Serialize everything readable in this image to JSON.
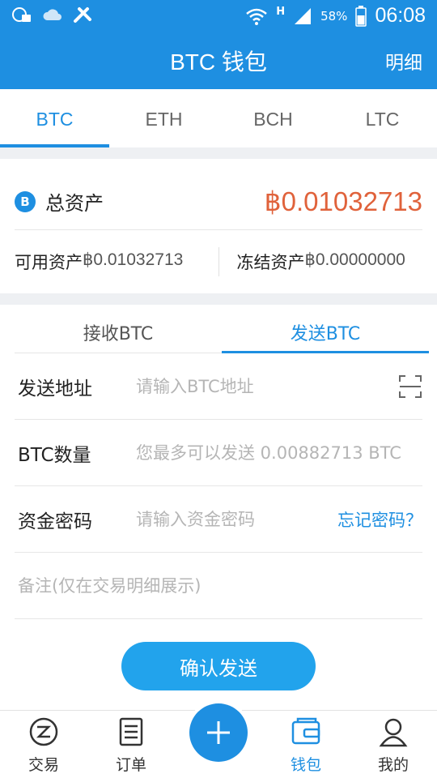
{
  "status_bar": {
    "signal_type": "H",
    "battery_percent": "58%",
    "time": "06:08"
  },
  "header": {
    "title": "BTC 钱包",
    "right_link": "明细"
  },
  "coin_tabs": [
    {
      "label": "BTC",
      "active": true
    },
    {
      "label": "ETH",
      "active": false
    },
    {
      "label": "BCH",
      "active": false
    },
    {
      "label": "LTC",
      "active": false
    }
  ],
  "assets": {
    "coin_badge": "B",
    "total_label": "总资产",
    "total_value": "฿0.01032713",
    "available_label": "可用资产",
    "available_value": "฿0.01032713",
    "frozen_label": "冻结资产",
    "frozen_value": "฿0.00000000"
  },
  "send_tabs": [
    {
      "label": "接收BTC",
      "active": false
    },
    {
      "label": "发送BTC",
      "active": true
    }
  ],
  "form": {
    "address_label": "发送地址",
    "address_placeholder": "请输入BTC地址",
    "amount_label": "BTC数量",
    "amount_placeholder": "您最多可以发送 0.00882713 BTC",
    "password_label": "资金密码",
    "password_placeholder": "请输入资金密码",
    "forgot_password": "忘记密码？",
    "note_placeholder": "备注(仅在交易明细展示)"
  },
  "confirm_button": "确认发送",
  "bottom_nav": [
    {
      "label": "交易",
      "icon": "trade-icon",
      "active": false
    },
    {
      "label": "订单",
      "icon": "orders-icon",
      "active": false
    },
    {
      "label": "钱包",
      "icon": "wallet-icon",
      "active": true
    },
    {
      "label": "我的",
      "icon": "profile-icon",
      "active": false
    }
  ],
  "colors": {
    "primary": "#1e8fe1",
    "accent_value": "#e0623b",
    "button": "#22a3ec"
  }
}
